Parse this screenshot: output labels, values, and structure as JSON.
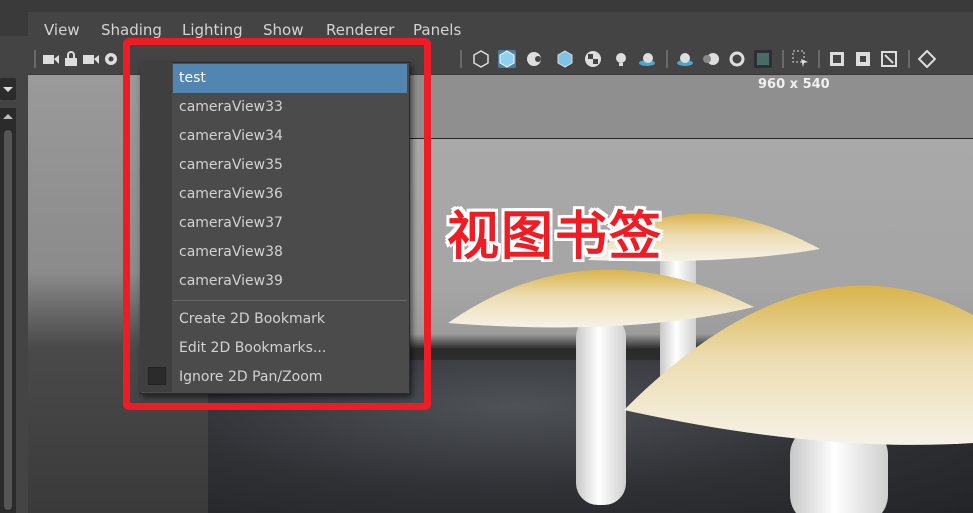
{
  "menubar": {
    "items": [
      "View",
      "Shading",
      "Lighting",
      "Show",
      "Renderer",
      "Panels"
    ]
  },
  "viewport": {
    "resolution_label": "960 x 540"
  },
  "bookmark_menu": {
    "items": [
      {
        "label": "test",
        "selected": true
      },
      {
        "label": "cameraView33"
      },
      {
        "label": "cameraView34"
      },
      {
        "label": "cameraView35"
      },
      {
        "label": "cameraView36"
      },
      {
        "label": "cameraView37"
      },
      {
        "label": "cameraView38"
      },
      {
        "label": "cameraView39"
      }
    ],
    "actions": [
      {
        "label": "Create 2D Bookmark"
      },
      {
        "label": "Edit 2D Bookmarks..."
      },
      {
        "label": "Ignore 2D Pan/Zoom"
      }
    ]
  },
  "annotation": {
    "text": "视图书签",
    "color": "#ee1c24"
  },
  "colors": {
    "selection": "#5286b0",
    "highlight_frame": "#ee1c24",
    "panel": "#444444"
  }
}
